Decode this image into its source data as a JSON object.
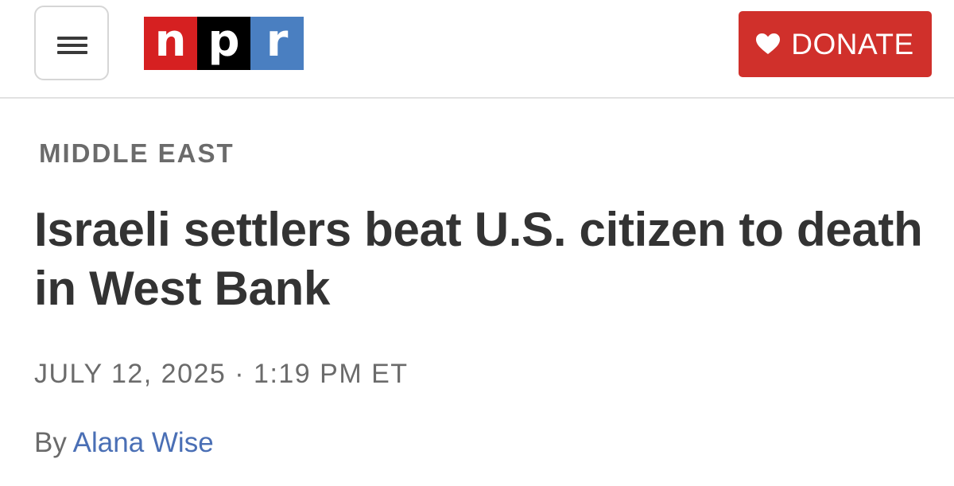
{
  "header": {
    "menu_icon": "hamburger-menu-icon",
    "logo": {
      "letters": [
        "n",
        "p",
        "r"
      ],
      "colors": [
        "#d62021",
        "#000000",
        "#4a7fc1"
      ]
    },
    "donate": {
      "label": "DONATE",
      "icon": "heart-icon",
      "background": "#d0302b"
    }
  },
  "article": {
    "section": "MIDDLE EAST",
    "headline": "Israeli settlers beat U.S. citizen to death in West Bank",
    "date": "JULY 12, 2025",
    "separator": "·",
    "time": "1:19 PM ET",
    "byline_prefix": "By",
    "author": "Alana Wise",
    "author_color": "#4a6fb5"
  }
}
